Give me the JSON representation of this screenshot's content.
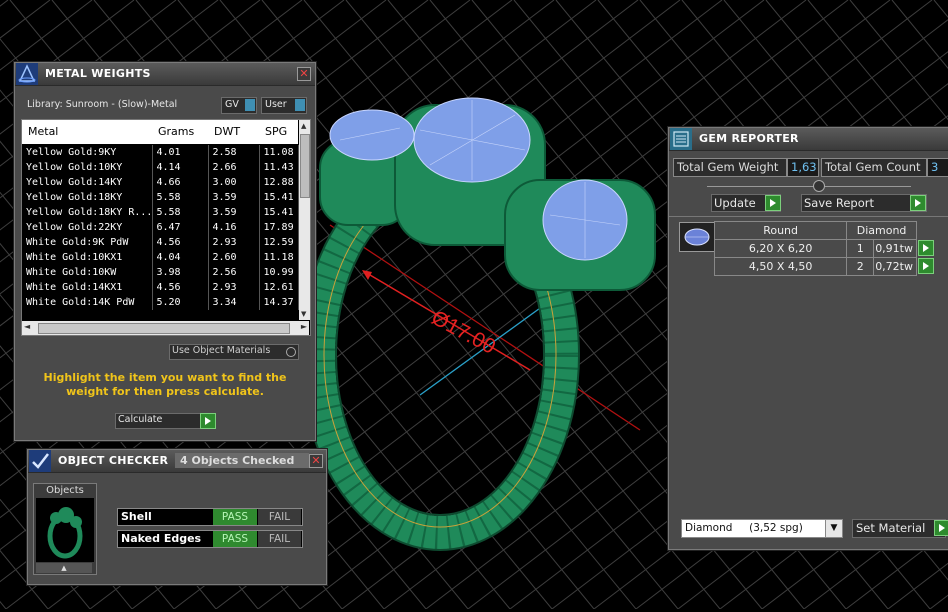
{
  "viewport": {
    "dimension_label": "Ø17.00"
  },
  "metal_weights": {
    "title": "METAL WEIGHTS",
    "library": "Library: Sunroom - (Slow)-Metal",
    "toggle_gv": "GV",
    "toggle_user": "User",
    "columns": [
      "Metal",
      "Grams",
      "DWT",
      "SPG"
    ],
    "rows": [
      [
        "Yellow Gold:9KY",
        "4.01",
        "2.58",
        "11.08"
      ],
      [
        "Yellow Gold:10KY",
        "4.14",
        "2.66",
        "11.43"
      ],
      [
        "Yellow Gold:14KY",
        "4.66",
        "3.00",
        "12.88"
      ],
      [
        "Yellow Gold:18KY",
        "5.58",
        "3.59",
        "15.41"
      ],
      [
        "Yellow Gold:18KY R...",
        "5.58",
        "3.59",
        "15.41"
      ],
      [
        "Yellow Gold:22KY",
        "6.47",
        "4.16",
        "17.89"
      ],
      [
        "White Gold:9K PdW",
        "4.56",
        "2.93",
        "12.59"
      ],
      [
        "White Gold:10KX1",
        "4.04",
        "2.60",
        "11.18"
      ],
      [
        "White Gold:10KW",
        "3.98",
        "2.56",
        "10.99"
      ],
      [
        "White Gold:14KX1",
        "4.56",
        "2.93",
        "12.61"
      ],
      [
        "White Gold:14K PdW",
        "5.20",
        "3.34",
        "14.37"
      ]
    ],
    "use_object_materials": "Use Object Materials",
    "hint": "Highlight the item you want to find the weight for then press calculate.",
    "calculate": "Calculate"
  },
  "object_checker": {
    "title": "OBJECT CHECKER",
    "status": "4 Objects Checked",
    "objects_label": "Objects",
    "checks": [
      {
        "name": "Shell",
        "pass": "PASS",
        "fail": "FAIL"
      },
      {
        "name": "Naked Edges",
        "pass": "PASS",
        "fail": "FAIL"
      }
    ]
  },
  "gem_reporter": {
    "title": "GEM REPORTER",
    "total_weight_label": "Total Gem Weight",
    "total_weight": "1,63",
    "total_count_label": "Total Gem Count",
    "total_count": "3",
    "update": "Update",
    "save_report": "Save Report",
    "shape_header": "Round",
    "material_header": "Diamond",
    "gems": [
      {
        "size": "6,20 X 6,20",
        "count": "1",
        "weight": "0,91tw"
      },
      {
        "size": "4,50 X 4,50",
        "count": "2",
        "weight": "0,72tw"
      }
    ],
    "material_select": "Diamond     (3,52 spg)",
    "set_material": "Set Material"
  }
}
